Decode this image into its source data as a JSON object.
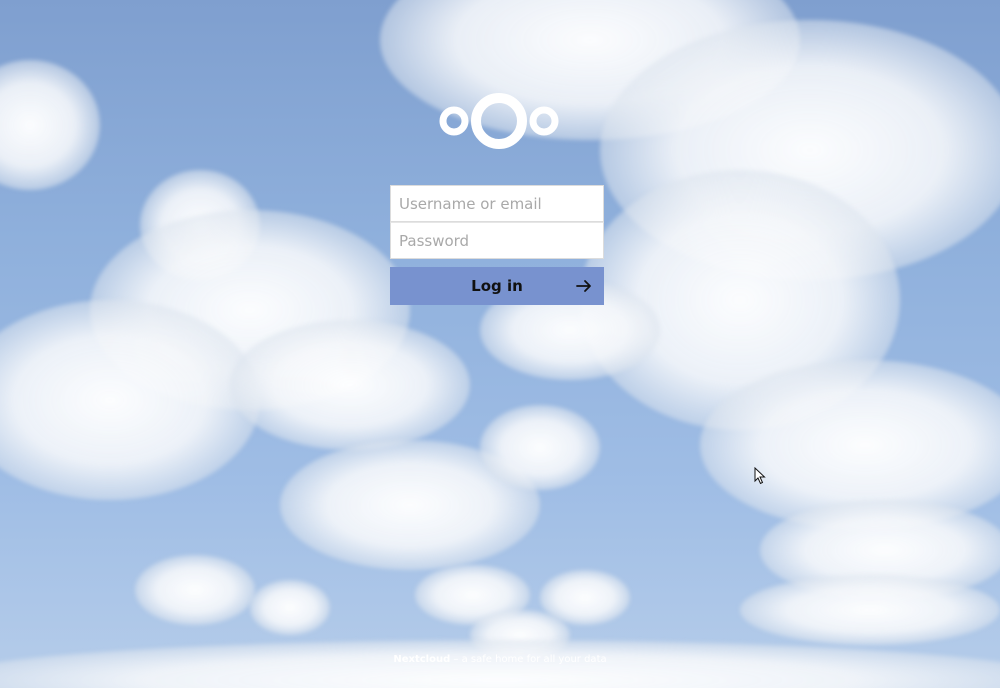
{
  "login": {
    "username_placeholder": "Username or email",
    "password_placeholder": "Password",
    "submit_label": "Log in"
  },
  "footer": {
    "brand": "Nextcloud",
    "tagline": " – a safe home for all your data"
  },
  "icons": {
    "logo": "nextcloud-logo",
    "submit": "arrow-right-icon",
    "pointer": "mouse-cursor-icon"
  },
  "colors": {
    "sky": "#8fb0dc",
    "button": "#7892cf",
    "input_bg": "#ffffff",
    "logo": "#ffffff"
  }
}
